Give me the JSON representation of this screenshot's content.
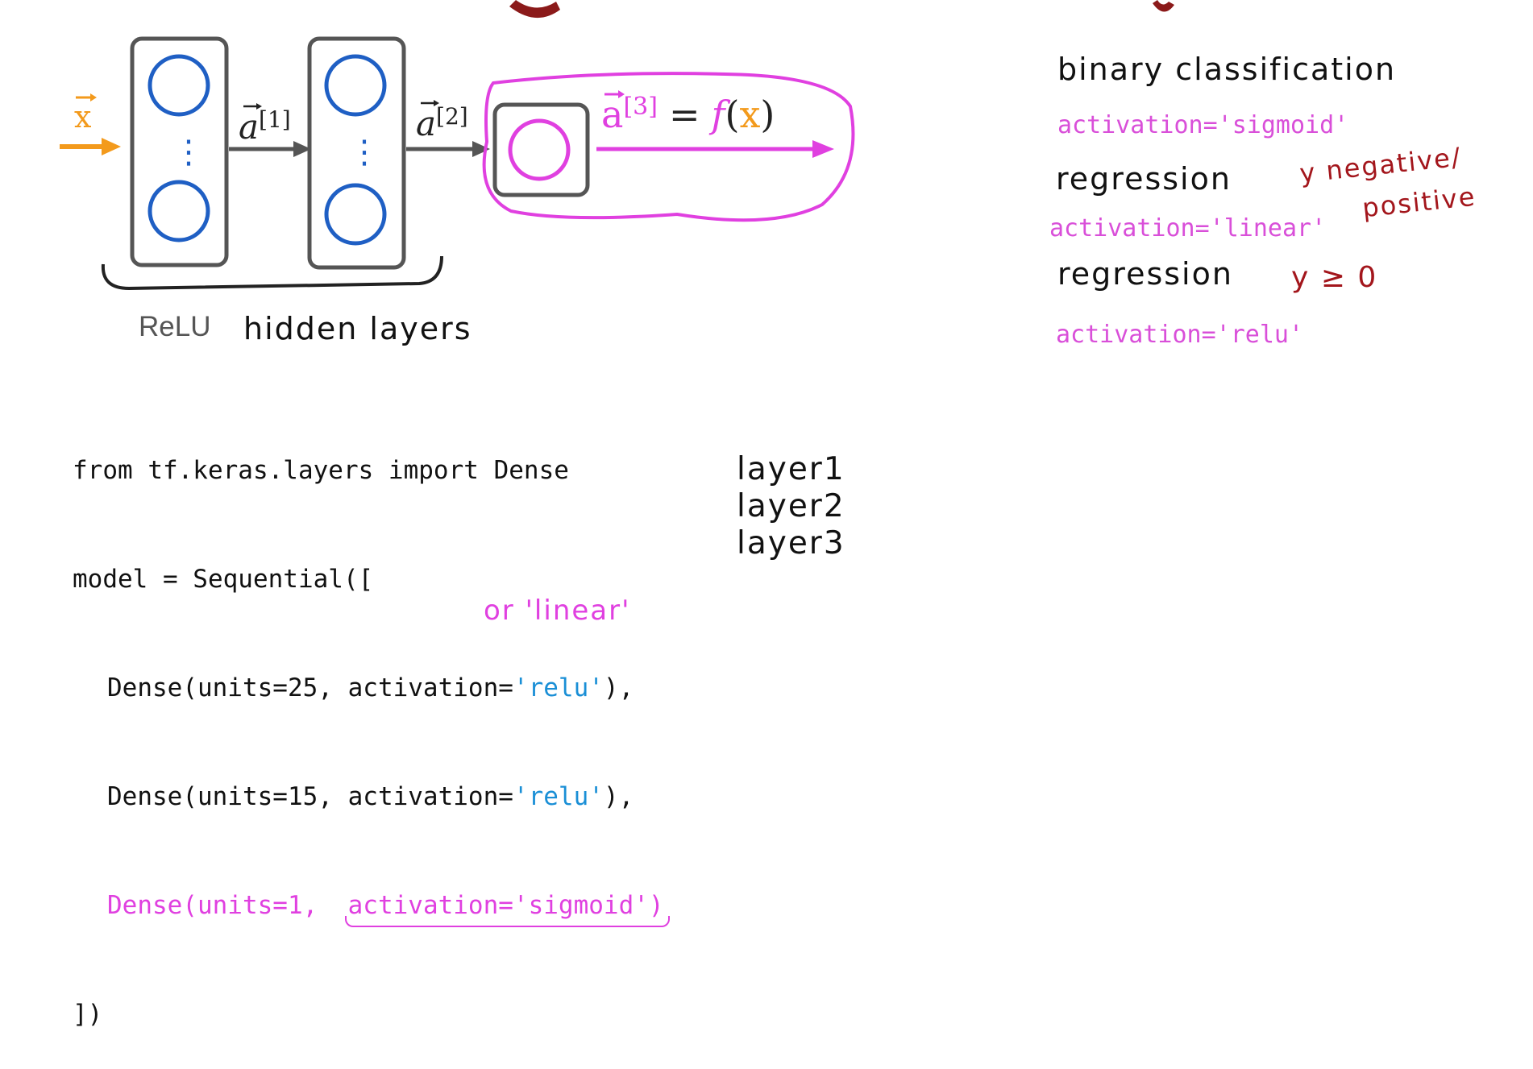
{
  "diagram": {
    "input_label": "x",
    "link1_label": "a",
    "link1_sup": "[1]",
    "link2_label": "a",
    "link2_sup": "[2]",
    "output_formula": {
      "lhs": "a",
      "sup": "[3]",
      "equals": "=",
      "func": "f",
      "open": "(",
      "arg": "x",
      "close": ")"
    },
    "vertical_ellipsis": "⋮",
    "relu_label": "ReLU",
    "hidden_layers_label": "hidden layers"
  },
  "code": {
    "line1": "from tf.keras.layers import Dense",
    "line2": "model = Sequential([",
    "line3_prefix": "Dense(units=25, activation=",
    "line3_str": "'relu'",
    "line3_suffix": "),",
    "line4_prefix": "Dense(units=15, activation=",
    "line4_str": "'relu'",
    "line4_suffix": "),",
    "line5_prefix": "Dense(units=1,  ",
    "line5_arg": "activation='sigmoid'",
    "line5_suffix": ")",
    "line6": "])"
  },
  "annotations": {
    "layer1": "layer1",
    "layer2": "layer2",
    "layer3": "layer3",
    "or_linear": "or 'linear'"
  },
  "notes": {
    "binary_classification": "binary classification",
    "act_sigmoid": "activation='sigmoid'",
    "regression1": "regression",
    "y_neg_pos_1": "y negative/",
    "y_neg_pos_2": "positive",
    "act_linear": "activation='linear'",
    "regression2": "regression",
    "y_ge_0": "y ≥ 0",
    "act_relu": "activation='relu'"
  },
  "colors": {
    "input_orange": "#f39a1c",
    "neuron_blue": "#1f5fc4",
    "box_gray": "#555555",
    "output_pink": "#e040e0",
    "handwriting_red": "#a3161c",
    "title_red": "#8b1a1a"
  }
}
